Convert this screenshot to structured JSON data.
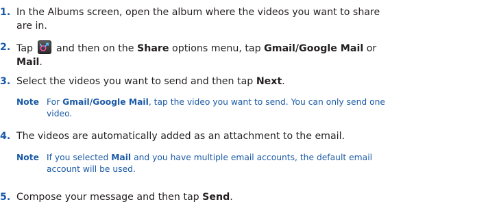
{
  "steps": [
    {
      "number": "1.",
      "lines": [
        {
          "parts": [
            {
              "t": "In the Albums screen, open the album where the videos you want to share",
              "b": false
            }
          ]
        },
        {
          "parts": [
            {
              "t": "are in.",
              "b": false
            }
          ]
        }
      ]
    },
    {
      "number": "2.",
      "lines": [
        {
          "parts": [
            {
              "t": "Tap",
              "b": false
            },
            {
              "icon": "share-icon"
            },
            {
              "t": "and then on the ",
              "b": false
            },
            {
              "t": "Share",
              "b": true
            },
            {
              "t": " options menu, tap ",
              "b": false
            },
            {
              "t": "Gmail/Google Mail",
              "b": true
            },
            {
              "t": " or",
              "b": false
            }
          ]
        },
        {
          "parts": [
            {
              "t": "Mail",
              "b": true
            },
            {
              "t": ".",
              "b": false
            }
          ]
        }
      ]
    },
    {
      "number": "3.",
      "lines": [
        {
          "parts": [
            {
              "t": "Select the videos you want to send and then tap ",
              "b": false
            },
            {
              "t": "Next",
              "b": true
            },
            {
              "t": ".",
              "b": false
            }
          ]
        }
      ],
      "note": {
        "label": "Note",
        "lines": [
          {
            "parts": [
              {
                "t": "For ",
                "b": false
              },
              {
                "t": "Gmail/Google Mail",
                "b": true
              },
              {
                "t": ", tap the video you want to send. You can only send one",
                "b": false
              }
            ]
          },
          {
            "parts": [
              {
                "t": "video.",
                "b": false
              }
            ]
          }
        ]
      }
    },
    {
      "number": "4.",
      "lines": [
        {
          "parts": [
            {
              "t": "The videos are automatically added as an attachment to the email.",
              "b": false
            }
          ]
        }
      ],
      "note": {
        "label": "Note",
        "lines": [
          {
            "parts": [
              {
                "t": "If you selected ",
                "b": false
              },
              {
                "t": "Mail",
                "b": true
              },
              {
                "t": " and you have multiple email accounts, the default email",
                "b": false
              }
            ]
          },
          {
            "parts": [
              {
                "t": "account will be used.",
                "b": false
              }
            ]
          }
        ]
      }
    },
    {
      "number": "5.",
      "lines": [
        {
          "parts": [
            {
              "t": "Compose your message and then tap ",
              "b": false
            },
            {
              "t": "Send",
              "b": true
            },
            {
              "t": ".",
              "b": false
            }
          ]
        }
      ]
    }
  ]
}
